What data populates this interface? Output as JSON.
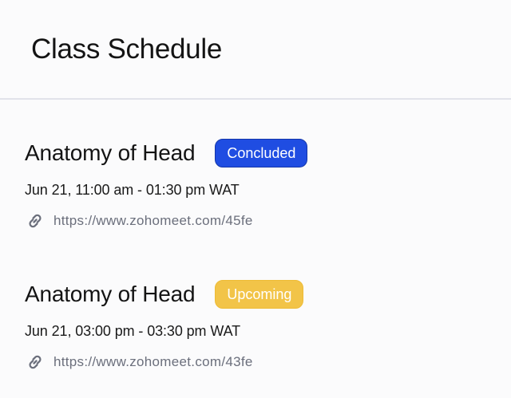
{
  "header": {
    "title": "Class Schedule"
  },
  "classes": [
    {
      "title": "Anatomy of Head",
      "status": "Concluded",
      "time": "Jun 21, 11:00 am - 01:30 pm WAT",
      "link": "https://www.zohomeet.com/45fe",
      "link_icon": "link-icon"
    },
    {
      "title": "Anatomy of Head",
      "status": "Upcoming",
      "time": "Jun 21, 03:00 pm - 03:30 pm WAT",
      "link": "https://www.zohomeet.com/43fe",
      "link_icon": "link-icon"
    }
  ],
  "colors": {
    "concluded_badge": "#1f4de2",
    "upcoming_badge": "#f2c448",
    "link_text": "#6b6f7c",
    "divider": "#e1e3ea"
  }
}
